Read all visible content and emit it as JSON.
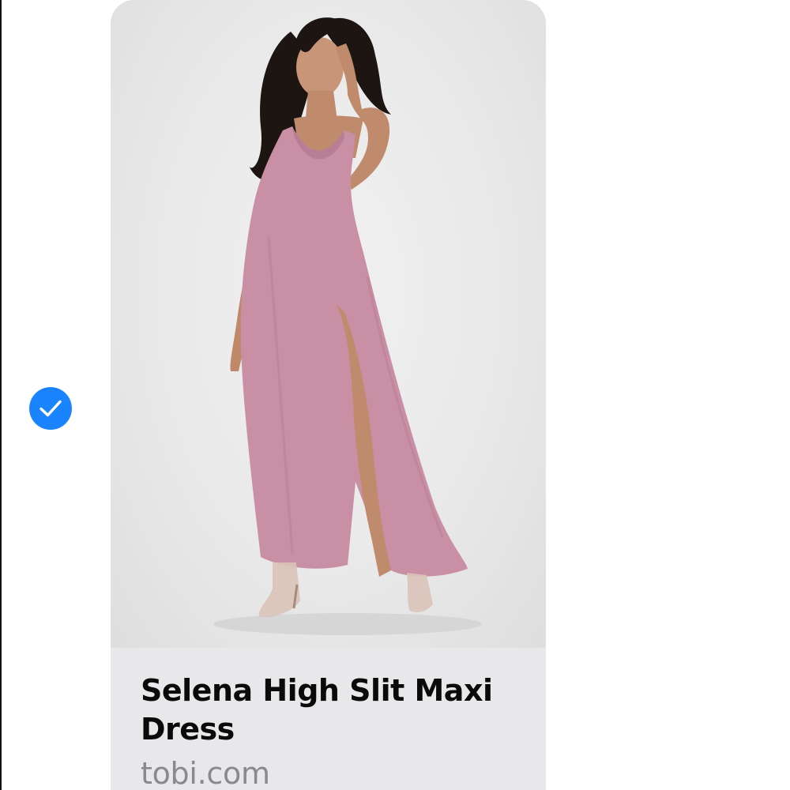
{
  "message": {
    "selected": true,
    "select_icon": "checkmark-circle-icon",
    "link_preview": {
      "image": "pink-maxi-dress-photo",
      "title": "Selena High Slit Maxi Dress",
      "domain": "tobi.com"
    }
  },
  "colors": {
    "accent": "#1a84ff",
    "footer_bg": "#e8e8ea",
    "title": "#0a0a0a",
    "domain": "#8a8a8e",
    "dress": "#c98fa5"
  }
}
